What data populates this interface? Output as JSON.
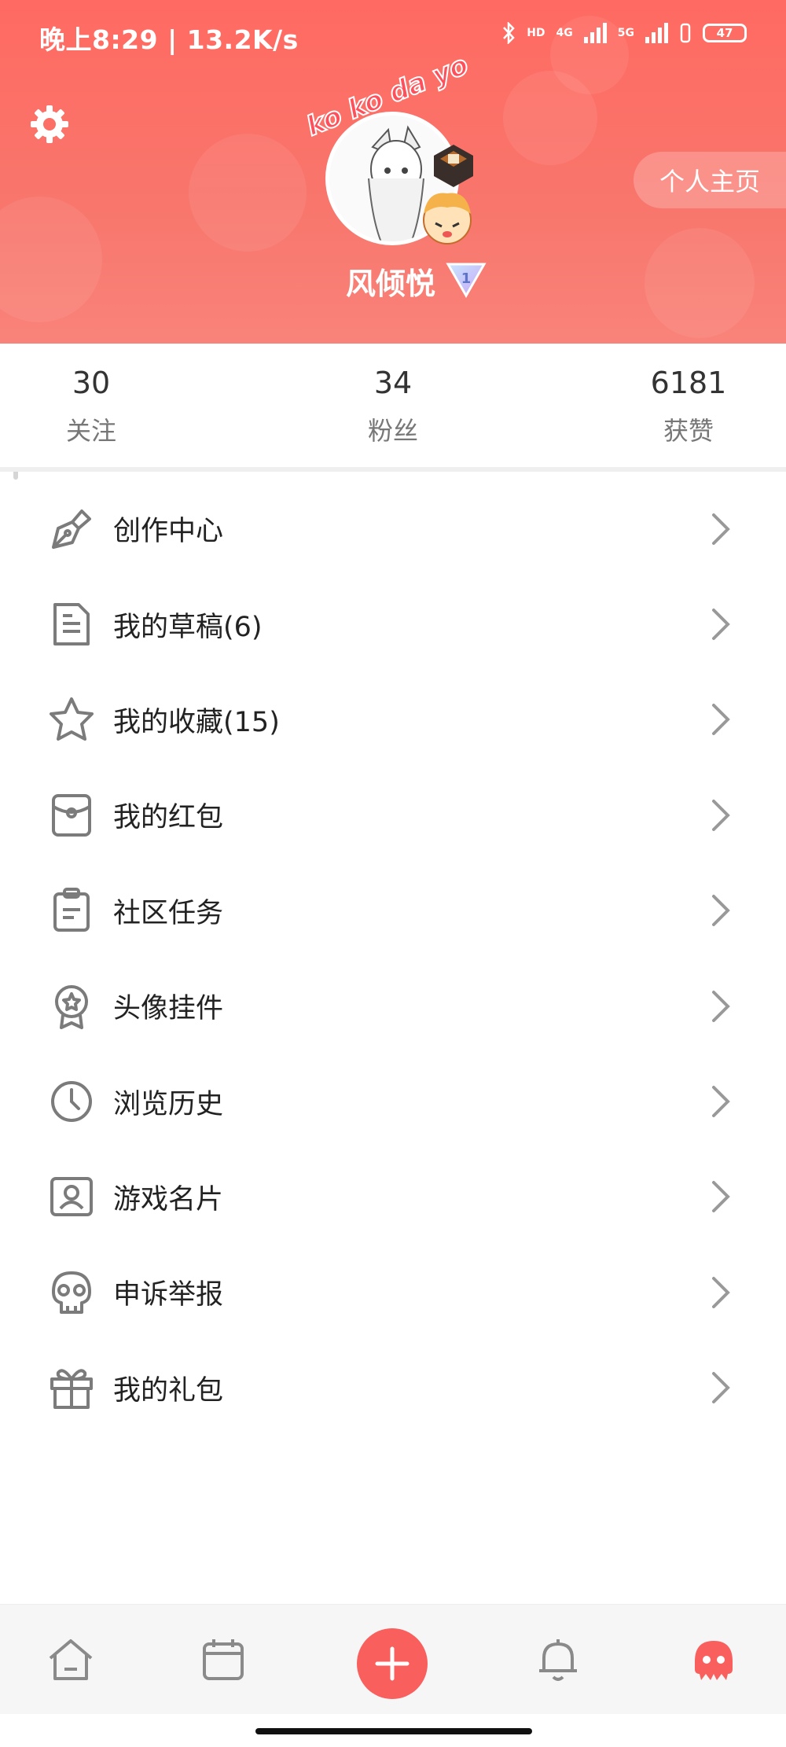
{
  "status_bar": {
    "time_speed": "晚上8:29 | 13.2K/s",
    "network_1": "4G",
    "network_2": "5G",
    "hd": "HD",
    "battery": "47"
  },
  "header": {
    "homepage_label": "个人主页",
    "avatar_frame_text": "ko ko da yo",
    "username": "风倾悦",
    "level": "1"
  },
  "stats": [
    {
      "value": "30",
      "label": "关注"
    },
    {
      "value": "34",
      "label": "粉丝"
    },
    {
      "value": "6181",
      "label": "获赞"
    }
  ],
  "menu": [
    {
      "label": "创作中心",
      "icon": "pen-icon"
    },
    {
      "label": "我的草稿(6)",
      "icon": "document-icon"
    },
    {
      "label": "我的收藏(15)",
      "icon": "star-icon"
    },
    {
      "label": "我的红包",
      "icon": "red-packet-icon"
    },
    {
      "label": "社区任务",
      "icon": "clipboard-icon"
    },
    {
      "label": "头像挂件",
      "icon": "badge-icon"
    },
    {
      "label": "浏览历史",
      "icon": "clock-icon"
    },
    {
      "label": "游戏名片",
      "icon": "id-card-icon"
    },
    {
      "label": "申诉举报",
      "icon": "skull-icon"
    },
    {
      "label": "我的礼包",
      "icon": "gift-icon"
    }
  ],
  "bottom_nav": {
    "items": [
      "home-icon",
      "calendar-icon",
      "add-icon",
      "bell-icon",
      "profile-octopus-icon"
    ],
    "accent": "#f85f5d"
  },
  "colors": {
    "header": "#ff6a62",
    "accent": "#f85f5d"
  }
}
